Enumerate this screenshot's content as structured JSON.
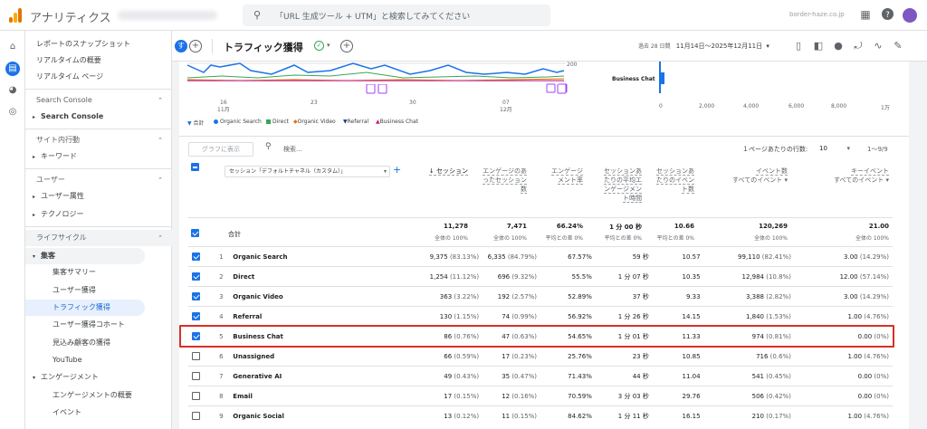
{
  "app": {
    "title": "アナリティクス",
    "search_placeholder": "「URL 生成ツール + UTM」と検索してみてください",
    "domain": "border-haze.co.jp",
    "icons": [
      "grid-icon",
      "help-icon",
      "avatar"
    ]
  },
  "sidebar": {
    "items": [
      {
        "label": "レポートのスナップショット"
      },
      {
        "label": "リアルタイムの概要"
      },
      {
        "label": "リアルタイム ページ"
      },
      {
        "label": "Search Console"
      },
      {
        "label": "Search Console"
      },
      {
        "label": "サイト内行動"
      },
      {
        "label": "キーワード"
      },
      {
        "label": "ユーザー"
      },
      {
        "label": "ユーザー属性"
      },
      {
        "label": "テクノロジー"
      },
      {
        "label": "ライフサイクル"
      },
      {
        "label": "集客"
      },
      {
        "label": "集客サマリー"
      },
      {
        "label": "ユーザー獲得"
      },
      {
        "label": "トラフィック獲得"
      },
      {
        "label": "ユーザー獲得コホート"
      },
      {
        "label": "見込み顧客の獲得"
      },
      {
        "label": "YouTube"
      },
      {
        "label": "エンゲージメント"
      },
      {
        "label": "エンゲージメントの概要"
      },
      {
        "label": "イベント"
      }
    ]
  },
  "header": {
    "badge_letter": "す",
    "title": "トラフィック獲得",
    "date_prefix": "過去 28 日間",
    "date_range": "11月14日～2025年12月11日",
    "accent": "#1a73e8"
  },
  "chart": {
    "x_ticks": [
      "16",
      "23",
      "30",
      "07"
    ],
    "x_sub": [
      "11月",
      "",
      "",
      "12月"
    ],
    "y_tick": "200",
    "bar_label": "Business Chat",
    "bar_ticks": [
      "0",
      "2,000",
      "4,000",
      "6,000",
      "8,000",
      "1万"
    ]
  },
  "legend": {
    "items": [
      {
        "label": "合計",
        "color": "#1a73e8"
      },
      {
        "label": "Organic Search",
        "color": "#1a73e8"
      },
      {
        "label": "Direct",
        "color": "#34a853"
      },
      {
        "label": "Organic Video",
        "color": "#e8710a"
      },
      {
        "label": "Referral",
        "color": "#1a3a8c"
      },
      {
        "label": "Business Chat",
        "color": "#d01884"
      }
    ]
  },
  "controls": {
    "graph_button": "グラフに表示",
    "search_placeholder": "検索...",
    "rows_label": "１ページあたりの行数:",
    "rows_value": "10",
    "range": "1～9/9",
    "dimension": "セッション「デフォルトチャネル（カスタム）」"
  },
  "columns": [
    {
      "label": "↓ セッション"
    },
    {
      "label": "エンゲージのあったセッション数"
    },
    {
      "label": "エンゲージメント率"
    },
    {
      "label": "セッションあたりの平均エンゲージメント時間"
    },
    {
      "label": "セッションあたりのイベント数"
    },
    {
      "label": "イベント数",
      "sub": "すべてのイベント"
    },
    {
      "label": "キーイベント",
      "sub": "すべてのイベント"
    }
  ],
  "totals": {
    "label": "合計",
    "values": [
      "11,278",
      "7,471",
      "66.24%",
      "1 分 00 秒",
      "10.66",
      "120,269",
      "21.00"
    ],
    "subs": [
      "全体の 100%",
      "全体の 100%",
      "平均との差 0%",
      "平均との差 0%",
      "平均との差 0%",
      "全体の 100%",
      "全体の 100%"
    ]
  },
  "rows": [
    {
      "idx": "1",
      "checked": true,
      "channel": "Organic Search",
      "sessions": "9,375",
      "sessions_pct": "(83.13%)",
      "engaged": "6,335",
      "engaged_pct": "(84.79%)",
      "rate": "67.57%",
      "time": "59 秒",
      "per": "10.57",
      "events": "99,110",
      "events_pct": "(82.41%)",
      "key": "3.00",
      "key_pct": "(14.29%)"
    },
    {
      "idx": "2",
      "checked": true,
      "channel": "Direct",
      "sessions": "1,254",
      "sessions_pct": "(11.12%)",
      "engaged": "696",
      "engaged_pct": "(9.32%)",
      "rate": "55.5%",
      "time": "1 分 07 秒",
      "per": "10.35",
      "events": "12,984",
      "events_pct": "(10.8%)",
      "key": "12.00",
      "key_pct": "(57.14%)"
    },
    {
      "idx": "3",
      "checked": true,
      "channel": "Organic Video",
      "sessions": "363",
      "sessions_pct": "(3.22%)",
      "engaged": "192",
      "engaged_pct": "(2.57%)",
      "rate": "52.89%",
      "time": "37 秒",
      "per": "9.33",
      "events": "3,388",
      "events_pct": "(2.82%)",
      "key": "3.00",
      "key_pct": "(14.29%)"
    },
    {
      "idx": "4",
      "checked": true,
      "channel": "Referral",
      "sessions": "130",
      "sessions_pct": "(1.15%)",
      "engaged": "74",
      "engaged_pct": "(0.99%)",
      "rate": "56.92%",
      "time": "1 分 26 秒",
      "per": "14.15",
      "events": "1,840",
      "events_pct": "(1.53%)",
      "key": "1.00",
      "key_pct": "(4.76%)"
    },
    {
      "idx": "5",
      "checked": true,
      "channel": "Business Chat",
      "sessions": "86",
      "sessions_pct": "(0.76%)",
      "engaged": "47",
      "engaged_pct": "(0.63%)",
      "rate": "54.65%",
      "time": "1 分 01 秒",
      "per": "11.33",
      "events": "974",
      "events_pct": "(0.81%)",
      "key": "0.00",
      "key_pct": "(0%)"
    },
    {
      "idx": "6",
      "checked": false,
      "channel": "Unassigned",
      "sessions": "66",
      "sessions_pct": "(0.59%)",
      "engaged": "17",
      "engaged_pct": "(0.23%)",
      "rate": "25.76%",
      "time": "23 秒",
      "per": "10.85",
      "events": "716",
      "events_pct": "(0.6%)",
      "key": "1.00",
      "key_pct": "(4.76%)"
    },
    {
      "idx": "7",
      "checked": false,
      "channel": "Generative AI",
      "sessions": "49",
      "sessions_pct": "(0.43%)",
      "engaged": "35",
      "engaged_pct": "(0.47%)",
      "rate": "71.43%",
      "time": "44 秒",
      "per": "11.04",
      "events": "541",
      "events_pct": "(0.45%)",
      "key": "0.00",
      "key_pct": "(0%)"
    },
    {
      "idx": "8",
      "checked": false,
      "channel": "Email",
      "sessions": "17",
      "sessions_pct": "(0.15%)",
      "engaged": "12",
      "engaged_pct": "(0.16%)",
      "rate": "70.59%",
      "time": "3 分 03 秒",
      "per": "29.76",
      "events": "506",
      "events_pct": "(0.42%)",
      "key": "0.00",
      "key_pct": "(0%)"
    },
    {
      "idx": "9",
      "checked": false,
      "channel": "Organic Social",
      "sessions": "13",
      "sessions_pct": "(0.12%)",
      "engaged": "11",
      "engaged_pct": "(0.15%)",
      "rate": "84.62%",
      "time": "1 分 11 秒",
      "per": "16.15",
      "events": "210",
      "events_pct": "(0.17%)",
      "key": "1.00",
      "key_pct": "(4.76%)"
    }
  ]
}
